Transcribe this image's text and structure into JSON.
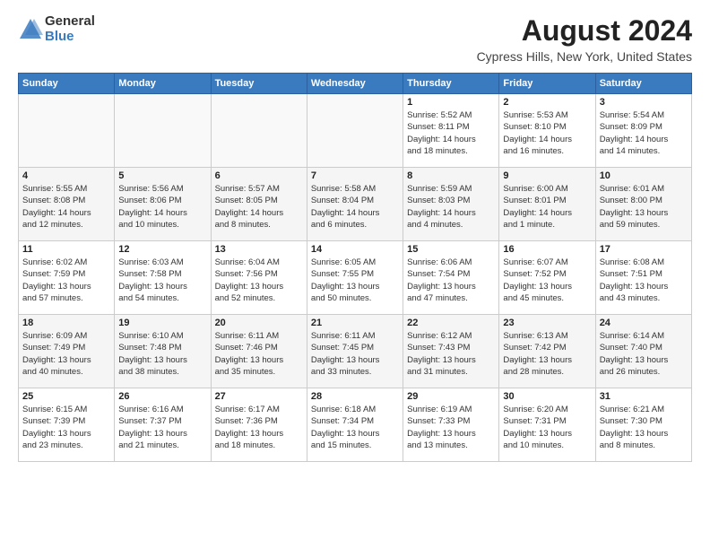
{
  "header": {
    "logo_general": "General",
    "logo_blue": "Blue",
    "month_year": "August 2024",
    "location": "Cypress Hills, New York, United States"
  },
  "days_of_week": [
    "Sunday",
    "Monday",
    "Tuesday",
    "Wednesday",
    "Thursday",
    "Friday",
    "Saturday"
  ],
  "weeks": [
    [
      {
        "day": "",
        "info": ""
      },
      {
        "day": "",
        "info": ""
      },
      {
        "day": "",
        "info": ""
      },
      {
        "day": "",
        "info": ""
      },
      {
        "day": "1",
        "info": "Sunrise: 5:52 AM\nSunset: 8:11 PM\nDaylight: 14 hours\nand 18 minutes."
      },
      {
        "day": "2",
        "info": "Sunrise: 5:53 AM\nSunset: 8:10 PM\nDaylight: 14 hours\nand 16 minutes."
      },
      {
        "day": "3",
        "info": "Sunrise: 5:54 AM\nSunset: 8:09 PM\nDaylight: 14 hours\nand 14 minutes."
      }
    ],
    [
      {
        "day": "4",
        "info": "Sunrise: 5:55 AM\nSunset: 8:08 PM\nDaylight: 14 hours\nand 12 minutes."
      },
      {
        "day": "5",
        "info": "Sunrise: 5:56 AM\nSunset: 8:06 PM\nDaylight: 14 hours\nand 10 minutes."
      },
      {
        "day": "6",
        "info": "Sunrise: 5:57 AM\nSunset: 8:05 PM\nDaylight: 14 hours\nand 8 minutes."
      },
      {
        "day": "7",
        "info": "Sunrise: 5:58 AM\nSunset: 8:04 PM\nDaylight: 14 hours\nand 6 minutes."
      },
      {
        "day": "8",
        "info": "Sunrise: 5:59 AM\nSunset: 8:03 PM\nDaylight: 14 hours\nand 4 minutes."
      },
      {
        "day": "9",
        "info": "Sunrise: 6:00 AM\nSunset: 8:01 PM\nDaylight: 14 hours\nand 1 minute."
      },
      {
        "day": "10",
        "info": "Sunrise: 6:01 AM\nSunset: 8:00 PM\nDaylight: 13 hours\nand 59 minutes."
      }
    ],
    [
      {
        "day": "11",
        "info": "Sunrise: 6:02 AM\nSunset: 7:59 PM\nDaylight: 13 hours\nand 57 minutes."
      },
      {
        "day": "12",
        "info": "Sunrise: 6:03 AM\nSunset: 7:58 PM\nDaylight: 13 hours\nand 54 minutes."
      },
      {
        "day": "13",
        "info": "Sunrise: 6:04 AM\nSunset: 7:56 PM\nDaylight: 13 hours\nand 52 minutes."
      },
      {
        "day": "14",
        "info": "Sunrise: 6:05 AM\nSunset: 7:55 PM\nDaylight: 13 hours\nand 50 minutes."
      },
      {
        "day": "15",
        "info": "Sunrise: 6:06 AM\nSunset: 7:54 PM\nDaylight: 13 hours\nand 47 minutes."
      },
      {
        "day": "16",
        "info": "Sunrise: 6:07 AM\nSunset: 7:52 PM\nDaylight: 13 hours\nand 45 minutes."
      },
      {
        "day": "17",
        "info": "Sunrise: 6:08 AM\nSunset: 7:51 PM\nDaylight: 13 hours\nand 43 minutes."
      }
    ],
    [
      {
        "day": "18",
        "info": "Sunrise: 6:09 AM\nSunset: 7:49 PM\nDaylight: 13 hours\nand 40 minutes."
      },
      {
        "day": "19",
        "info": "Sunrise: 6:10 AM\nSunset: 7:48 PM\nDaylight: 13 hours\nand 38 minutes."
      },
      {
        "day": "20",
        "info": "Sunrise: 6:11 AM\nSunset: 7:46 PM\nDaylight: 13 hours\nand 35 minutes."
      },
      {
        "day": "21",
        "info": "Sunrise: 6:11 AM\nSunset: 7:45 PM\nDaylight: 13 hours\nand 33 minutes."
      },
      {
        "day": "22",
        "info": "Sunrise: 6:12 AM\nSunset: 7:43 PM\nDaylight: 13 hours\nand 31 minutes."
      },
      {
        "day": "23",
        "info": "Sunrise: 6:13 AM\nSunset: 7:42 PM\nDaylight: 13 hours\nand 28 minutes."
      },
      {
        "day": "24",
        "info": "Sunrise: 6:14 AM\nSunset: 7:40 PM\nDaylight: 13 hours\nand 26 minutes."
      }
    ],
    [
      {
        "day": "25",
        "info": "Sunrise: 6:15 AM\nSunset: 7:39 PM\nDaylight: 13 hours\nand 23 minutes."
      },
      {
        "day": "26",
        "info": "Sunrise: 6:16 AM\nSunset: 7:37 PM\nDaylight: 13 hours\nand 21 minutes."
      },
      {
        "day": "27",
        "info": "Sunrise: 6:17 AM\nSunset: 7:36 PM\nDaylight: 13 hours\nand 18 minutes."
      },
      {
        "day": "28",
        "info": "Sunrise: 6:18 AM\nSunset: 7:34 PM\nDaylight: 13 hours\nand 15 minutes."
      },
      {
        "day": "29",
        "info": "Sunrise: 6:19 AM\nSunset: 7:33 PM\nDaylight: 13 hours\nand 13 minutes."
      },
      {
        "day": "30",
        "info": "Sunrise: 6:20 AM\nSunset: 7:31 PM\nDaylight: 13 hours\nand 10 minutes."
      },
      {
        "day": "31",
        "info": "Sunrise: 6:21 AM\nSunset: 7:30 PM\nDaylight: 13 hours\nand 8 minutes."
      }
    ]
  ]
}
